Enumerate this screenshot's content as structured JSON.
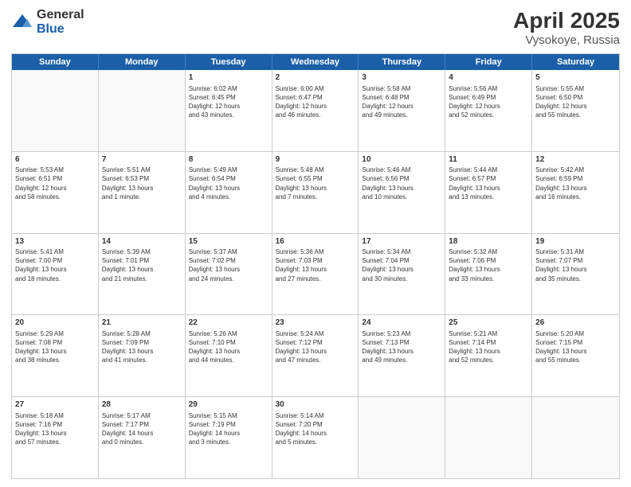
{
  "logo": {
    "general": "General",
    "blue": "Blue"
  },
  "title": "April 2025",
  "location": "Vysokoye, Russia",
  "header_days": [
    "Sunday",
    "Monday",
    "Tuesday",
    "Wednesday",
    "Thursday",
    "Friday",
    "Saturday"
  ],
  "rows": [
    [
      {
        "day": "",
        "text": "",
        "empty": true
      },
      {
        "day": "",
        "text": "",
        "empty": true
      },
      {
        "day": "1",
        "text": "Sunrise: 6:02 AM\nSunset: 6:45 PM\nDaylight: 12 hours\nand 43 minutes."
      },
      {
        "day": "2",
        "text": "Sunrise: 6:00 AM\nSunset: 6:47 PM\nDaylight: 12 hours\nand 46 minutes."
      },
      {
        "day": "3",
        "text": "Sunrise: 5:58 AM\nSunset: 6:48 PM\nDaylight: 12 hours\nand 49 minutes."
      },
      {
        "day": "4",
        "text": "Sunrise: 5:56 AM\nSunset: 6:49 PM\nDaylight: 12 hours\nand 52 minutes."
      },
      {
        "day": "5",
        "text": "Sunrise: 5:55 AM\nSunset: 6:50 PM\nDaylight: 12 hours\nand 55 minutes."
      }
    ],
    [
      {
        "day": "6",
        "text": "Sunrise: 5:53 AM\nSunset: 6:51 PM\nDaylight: 12 hours\nand 58 minutes."
      },
      {
        "day": "7",
        "text": "Sunrise: 5:51 AM\nSunset: 6:53 PM\nDaylight: 13 hours\nand 1 minute."
      },
      {
        "day": "8",
        "text": "Sunrise: 5:49 AM\nSunset: 6:54 PM\nDaylight: 13 hours\nand 4 minutes."
      },
      {
        "day": "9",
        "text": "Sunrise: 5:48 AM\nSunset: 6:55 PM\nDaylight: 13 hours\nand 7 minutes."
      },
      {
        "day": "10",
        "text": "Sunrise: 5:46 AM\nSunset: 6:56 PM\nDaylight: 13 hours\nand 10 minutes."
      },
      {
        "day": "11",
        "text": "Sunrise: 5:44 AM\nSunset: 6:57 PM\nDaylight: 13 hours\nand 13 minutes."
      },
      {
        "day": "12",
        "text": "Sunrise: 5:42 AM\nSunset: 6:59 PM\nDaylight: 13 hours\nand 16 minutes."
      }
    ],
    [
      {
        "day": "13",
        "text": "Sunrise: 5:41 AM\nSunset: 7:00 PM\nDaylight: 13 hours\nand 18 minutes."
      },
      {
        "day": "14",
        "text": "Sunrise: 5:39 AM\nSunset: 7:01 PM\nDaylight: 13 hours\nand 21 minutes."
      },
      {
        "day": "15",
        "text": "Sunrise: 5:37 AM\nSunset: 7:02 PM\nDaylight: 13 hours\nand 24 minutes."
      },
      {
        "day": "16",
        "text": "Sunrise: 5:36 AM\nSunset: 7:03 PM\nDaylight: 13 hours\nand 27 minutes."
      },
      {
        "day": "17",
        "text": "Sunrise: 5:34 AM\nSunset: 7:04 PM\nDaylight: 13 hours\nand 30 minutes."
      },
      {
        "day": "18",
        "text": "Sunrise: 5:32 AM\nSunset: 7:06 PM\nDaylight: 13 hours\nand 33 minutes."
      },
      {
        "day": "19",
        "text": "Sunrise: 5:31 AM\nSunset: 7:07 PM\nDaylight: 13 hours\nand 35 minutes."
      }
    ],
    [
      {
        "day": "20",
        "text": "Sunrise: 5:29 AM\nSunset: 7:08 PM\nDaylight: 13 hours\nand 38 minutes."
      },
      {
        "day": "21",
        "text": "Sunrise: 5:28 AM\nSunset: 7:09 PM\nDaylight: 13 hours\nand 41 minutes."
      },
      {
        "day": "22",
        "text": "Sunrise: 5:26 AM\nSunset: 7:10 PM\nDaylight: 13 hours\nand 44 minutes."
      },
      {
        "day": "23",
        "text": "Sunrise: 5:24 AM\nSunset: 7:12 PM\nDaylight: 13 hours\nand 47 minutes."
      },
      {
        "day": "24",
        "text": "Sunrise: 5:23 AM\nSunset: 7:13 PM\nDaylight: 13 hours\nand 49 minutes."
      },
      {
        "day": "25",
        "text": "Sunrise: 5:21 AM\nSunset: 7:14 PM\nDaylight: 13 hours\nand 52 minutes."
      },
      {
        "day": "26",
        "text": "Sunrise: 5:20 AM\nSunset: 7:15 PM\nDaylight: 13 hours\nand 55 minutes."
      }
    ],
    [
      {
        "day": "27",
        "text": "Sunrise: 5:18 AM\nSunset: 7:16 PM\nDaylight: 13 hours\nand 57 minutes."
      },
      {
        "day": "28",
        "text": "Sunrise: 5:17 AM\nSunset: 7:17 PM\nDaylight: 14 hours\nand 0 minutes."
      },
      {
        "day": "29",
        "text": "Sunrise: 5:15 AM\nSunset: 7:19 PM\nDaylight: 14 hours\nand 3 minutes."
      },
      {
        "day": "30",
        "text": "Sunrise: 5:14 AM\nSunset: 7:20 PM\nDaylight: 14 hours\nand 5 minutes."
      },
      {
        "day": "",
        "text": "",
        "empty": true
      },
      {
        "day": "",
        "text": "",
        "empty": true
      },
      {
        "day": "",
        "text": "",
        "empty": true
      }
    ]
  ]
}
